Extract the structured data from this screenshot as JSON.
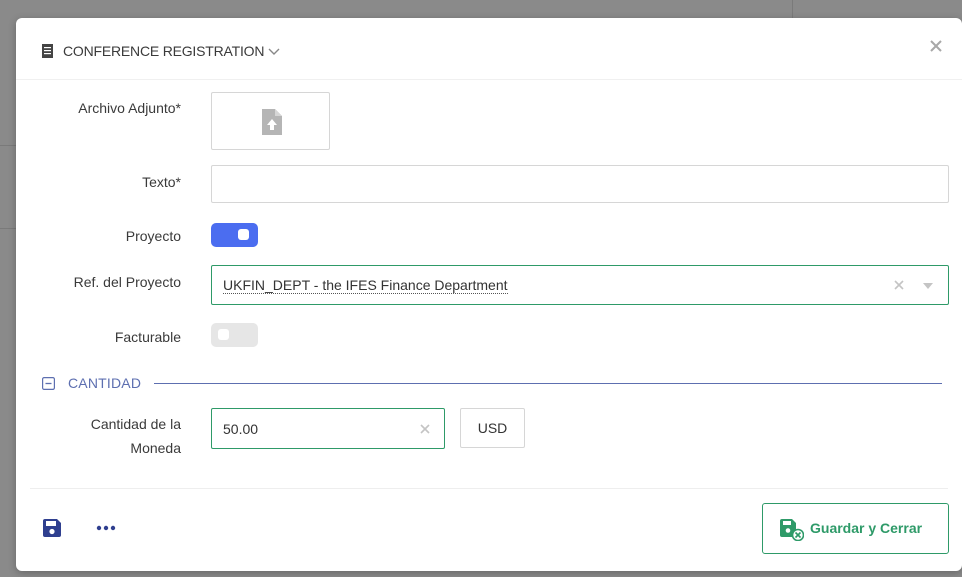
{
  "modal": {
    "title": "CONFERENCE REGISTRATION",
    "close_icon": "close-icon",
    "title_icon": "document-icon"
  },
  "form": {
    "attachment": {
      "label": "Archivo Adjunto*",
      "icon": "file-upload-icon"
    },
    "text": {
      "label": "Texto*",
      "value": "",
      "placeholder": ""
    },
    "project": {
      "label": "Proyecto",
      "enabled": true
    },
    "project_ref": {
      "label": "Ref. del Proyecto",
      "value": "UKFIN_DEPT - the IFES Finance Department"
    },
    "billable": {
      "label": "Facturable",
      "enabled": false
    }
  },
  "section_amount": {
    "title": "CANTIDAD",
    "currency_amount": {
      "label_line1": "Cantidad de la",
      "label_line2": "Moneda",
      "value": "50.00",
      "currency": "USD"
    }
  },
  "footer": {
    "save_close_label": "Guardar y Cerrar"
  },
  "colors": {
    "accent_green": "#2e9a68",
    "toggle_on": "#4b6df0",
    "section_blue": "#5d6fb0",
    "save_icon_blue": "#2f3f8f"
  }
}
